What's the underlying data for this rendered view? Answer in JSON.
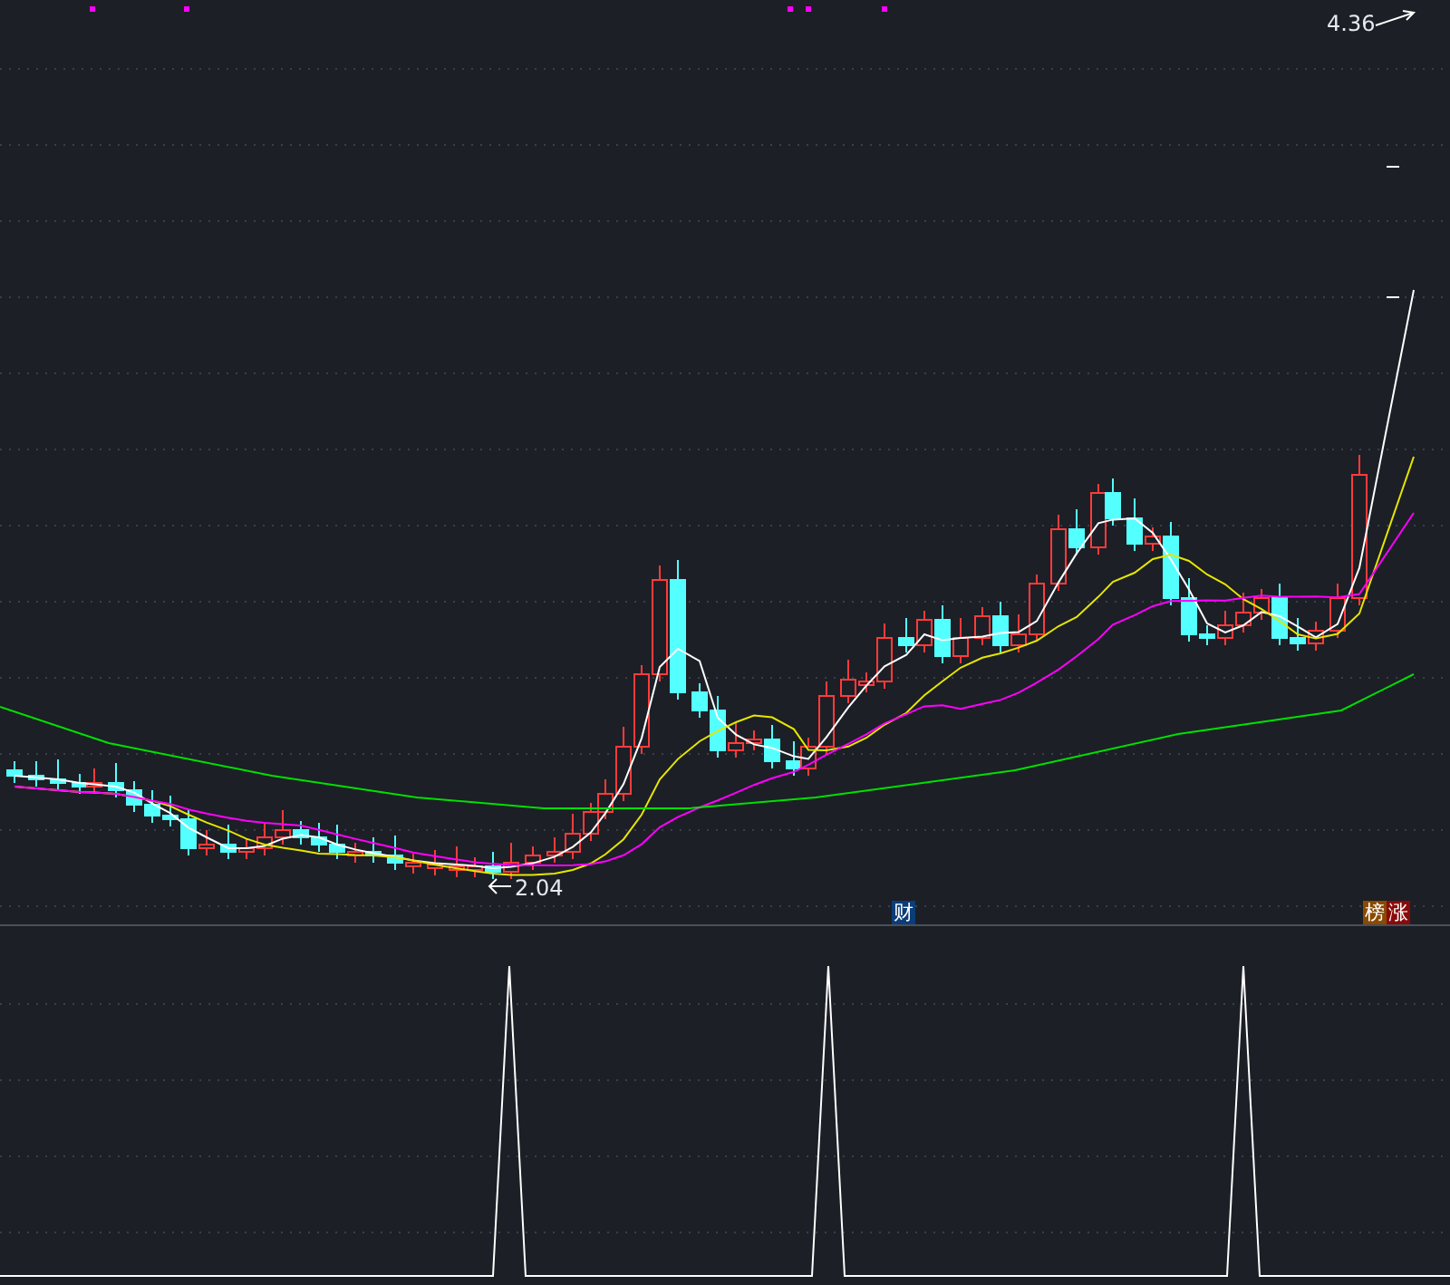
{
  "price_chart": {
    "high_label": {
      "text": "4.36"
    },
    "low_label": {
      "text": "2.04"
    },
    "event_badges": [
      {
        "text": "财",
        "kind": "finance"
      },
      {
        "text": "榜",
        "kind": "rank"
      },
      {
        "text": "涨",
        "kind": "limit"
      }
    ]
  }
}
